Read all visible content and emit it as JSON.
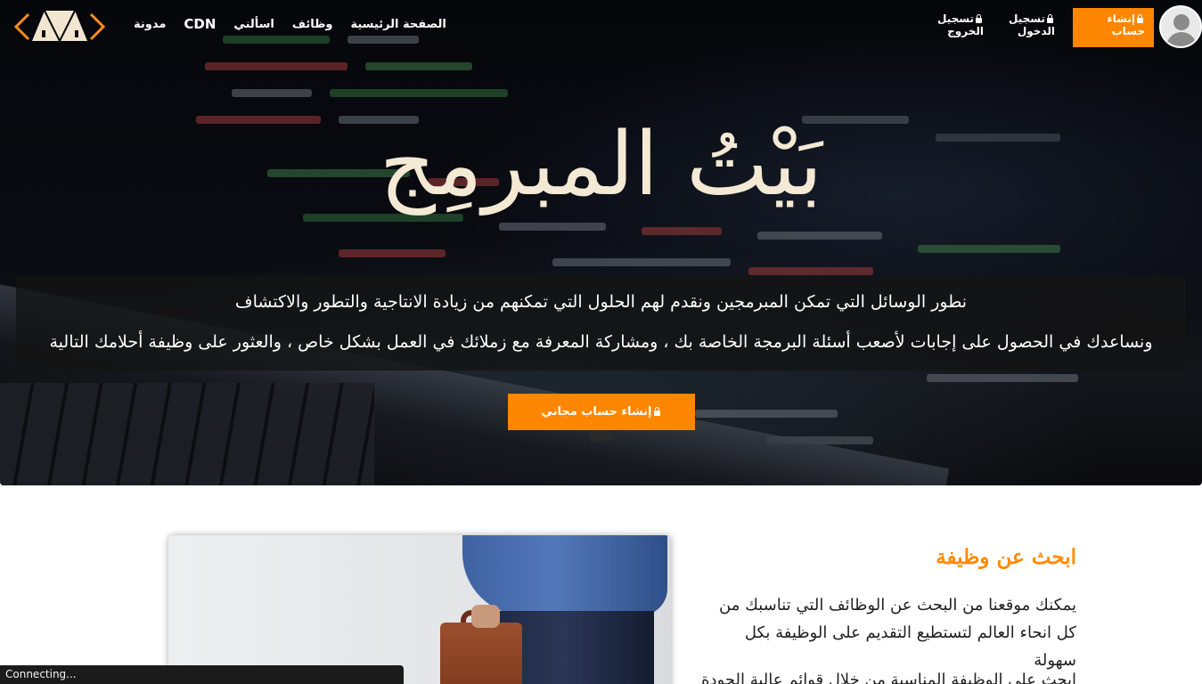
{
  "nav": {
    "links": [
      "مدونة",
      "CDN",
      "اسألني",
      "وظائف",
      "الصفحة الرئيسية"
    ],
    "register_label": "إنشاء حساب",
    "login_label": "تسجيل الدخول",
    "logout_label": "تسجيل الخروج"
  },
  "hero": {
    "title": "بَيْتُ المبرمِج",
    "line1": "نطور الوسائل التي تمكن المبرمجين ونقدم لهم الحلول التي تمكنهم من زيادة الانتاجية والتطور والاكتشاف",
    "line2": "ونساعدك في الحصول على إجابات لأصعب أسئلة البرمجة الخاصة بك ، ومشاركة المعرفة مع زملائك في العمل بشكل خاص ، والعثور على وظيفة أحلامك التالية",
    "cta_label": "إنشاء حساب مجاني"
  },
  "jobs_section": {
    "title": "ابحث عن وظيفة",
    "text1": "يمكنك موقعنا من البحث عن الوظائف التي تناسبك من كل انحاء العالم لتستطيع التقديم على الوظيفة بكل سهولة",
    "text2": "ابحث على الوظيفة المناسبة من خلال قوائم عالية الجودة"
  },
  "status_bar": {
    "text": "Connecting..."
  },
  "colors": {
    "accent": "#ff8600",
    "title_cream": "#f3e9d4",
    "section_title": "#ff8c00"
  }
}
